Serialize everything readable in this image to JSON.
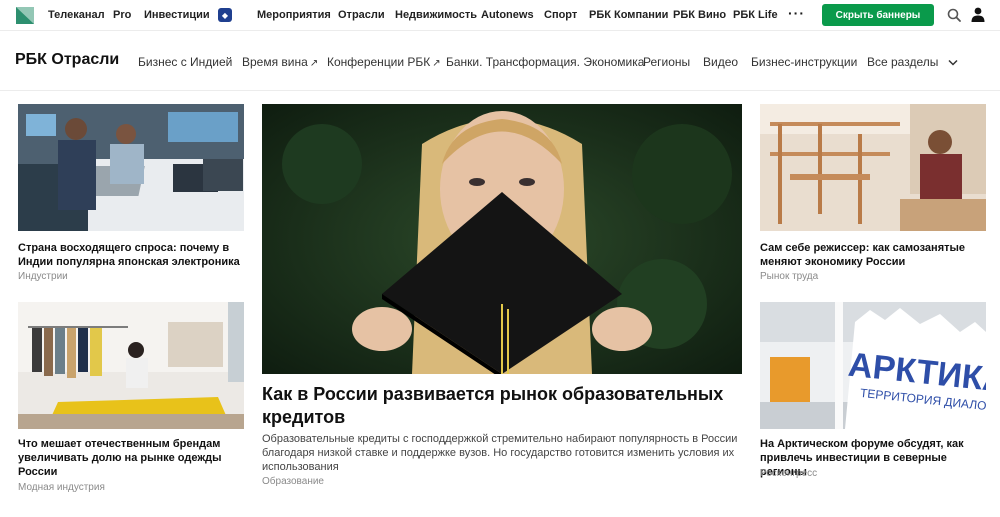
{
  "header": {
    "nav": [
      {
        "label": "Телеканал"
      },
      {
        "label": "Pro"
      },
      {
        "label": "Инвестиции"
      },
      {
        "label": "Мероприятия"
      },
      {
        "label": "Отрасли"
      },
      {
        "label": "Недвижимость"
      },
      {
        "label": "Autonews"
      },
      {
        "label": "Спорт"
      },
      {
        "label": "РБК Компании"
      },
      {
        "label": "РБК Вино"
      },
      {
        "label": "РБК Life"
      }
    ],
    "more_label": "···",
    "hide_banners_label": "Скрыть баннеры",
    "accent_color": "#0a9a4b"
  },
  "section": {
    "title": "РБК Отрасли",
    "nav": [
      {
        "label": "Бизнес с Индией"
      },
      {
        "label": "Время вина",
        "external": true
      },
      {
        "label": "Конференции РБК",
        "external": true
      },
      {
        "label": "Банки. Трансформация. Экономика"
      },
      {
        "label": "Регионы"
      },
      {
        "label": "Видео"
      },
      {
        "label": "Бизнес-инструкции"
      },
      {
        "label": "Все разделы"
      }
    ]
  },
  "articles": {
    "left_top": {
      "title": "Страна восходящего спроса: почему в Индии популярна японская электроника",
      "category": "Индустрии"
    },
    "left_bottom": {
      "title": "Что мешает отечественным брендам увеличивать долю на рынке одежды России",
      "category": "Модная индустрия"
    },
    "hero": {
      "title": "Как в России развивается рынок образовательных кредитов",
      "lead": "Образовательные кредиты с господдержкой стремительно набирают популярность в России благодаря низкой ставке и поддержке вузов. Но государство готовится изменить условия их использования",
      "category": "Образование"
    },
    "right_top": {
      "title": "Сам себе режиссер: как самозанятые меняют экономику России",
      "category": "Рынок труда"
    },
    "right_bottom": {
      "title": "На Арктическом форуме обсудят, как привлечь инвестиции в северные регионы",
      "category": "Росконгресс"
    }
  }
}
